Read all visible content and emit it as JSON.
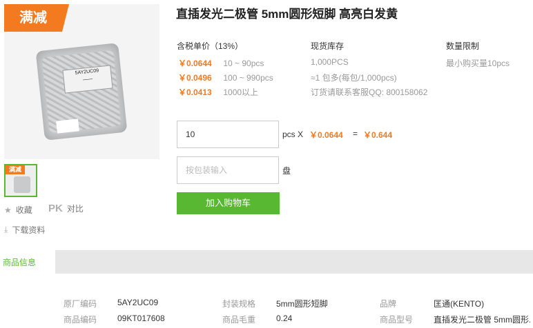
{
  "product": {
    "title": "直插发光二极管 5mm圆形短脚 高亮白发黄",
    "badge": "满减",
    "thumb_badge": "满减",
    "image_label": [
      "5AY2UC09",
      "——"
    ]
  },
  "side_actions": {
    "favorite": "收藏",
    "compare_pk": "PK",
    "compare": "对比",
    "download": "下载资料"
  },
  "pricing": {
    "header": "含税单价（13%）",
    "tiers": [
      {
        "price": "￥0.0644",
        "range": "10 ~ 90pcs"
      },
      {
        "price": "￥0.0496",
        "range": "100 ~ 990pcs"
      },
      {
        "price": "￥0.0413",
        "range": "1000以上"
      }
    ]
  },
  "stock": {
    "header": "现货库存",
    "lines": [
      "1,000PCS",
      "≈1 包多(每包/1,000pcs)",
      "订货请联系客服QQ: 800158062"
    ]
  },
  "limit": {
    "header": "数量限制",
    "text": "最小购买量10pcs"
  },
  "order": {
    "qty_value": "10",
    "qty_unit": "pcs X",
    "unit_price": "￥0.0644",
    "equals": "=",
    "total": "￥0.644",
    "pack_placeholder": "按包装输入",
    "pack_unit": "盘",
    "add_to_cart": "加入购物车"
  },
  "tabs": {
    "active": "商品信息"
  },
  "attributes": [
    {
      "key": "原厂编码",
      "value": "5AY2UC09"
    },
    {
      "key": "封装规格",
      "value": "5mm圆形短脚"
    },
    {
      "key": "品牌",
      "value": "匡通(KENTO)"
    },
    {
      "key": "商品编码",
      "value": "09KT017608"
    },
    {
      "key": "商品毛重",
      "value": "0.24"
    },
    {
      "key": "商品型号",
      "value": "直插发光二极管 5mm圆形..."
    }
  ],
  "colors": {
    "accent_orange": "#f47a20",
    "accent_green": "#58b832"
  }
}
